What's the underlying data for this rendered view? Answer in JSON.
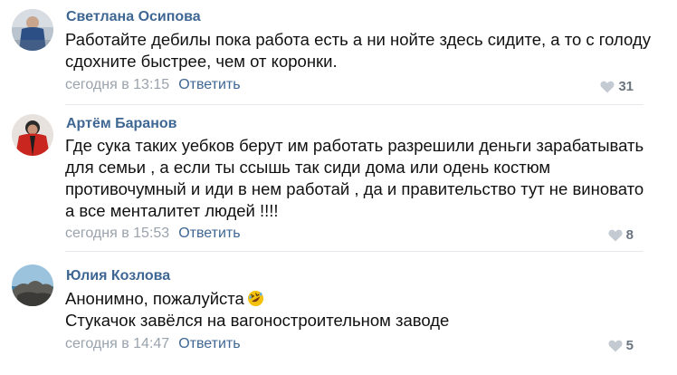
{
  "comments": [
    {
      "author": "Светлана Осипова",
      "text_lines": [
        "Работайте дебилы пока работа есть а ни нойте здесь сидите, а то с голоду",
        "сдохните быстрее, чем от коронки."
      ],
      "time": "сегодня в 13:15",
      "reply_label": "Ответить",
      "likes": "31",
      "avatar": "user-photo-blue-jacket"
    },
    {
      "author": "Артём Баранов",
      "text_lines": [
        "Где сука таких уебков берут им работать разрешили деньги зарабатывать",
        "для семьи , а если ты ссышь так сиди дома или одень костюм",
        "противочумный и иди в нем работай , да и правительство тут не виновато",
        "а все менталитет людей !!!!"
      ],
      "time": "сегодня в 15:53",
      "reply_label": "Ответить",
      "likes": "8",
      "avatar": "user-photo-red-jacket"
    },
    {
      "author": "Юлия Козлова",
      "text_lines": [
        "Анонимно, пожалуйста",
        "Стукачок завёлся на вагоностроительном заводе"
      ],
      "emoji": "rolling-on-floor-laughing-emoji",
      "time": "сегодня в 14:47",
      "reply_label": "Ответить",
      "likes": "5",
      "avatar": "user-photo-seaside-rocks"
    }
  ],
  "colors": {
    "author": "#3f6794",
    "reply_link": "#3f6794",
    "meta_text": "#9aa3ad",
    "like_count": "#6b7580",
    "like_icon": "#c4cad1",
    "divider": "#e5e8ec"
  }
}
